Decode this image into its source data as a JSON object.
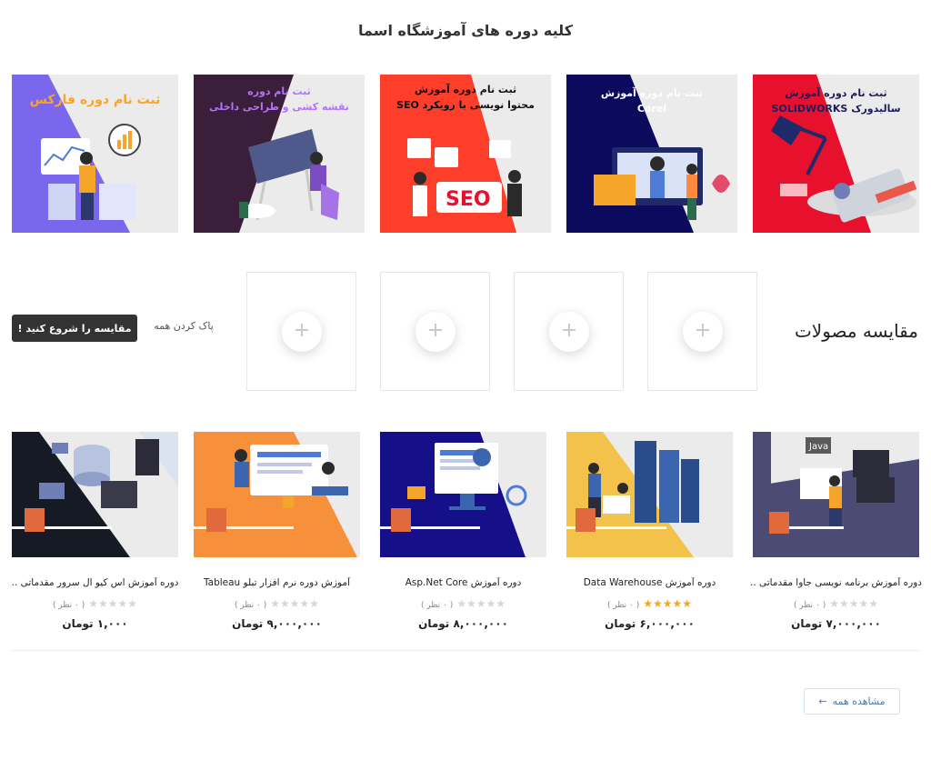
{
  "page_title": "کلیه دوره های آموزشگاه اسما",
  "banners": [
    {
      "line1": "ثبت نام دوره آموزش",
      "line2": "سالیدورک SOLIDWORKS",
      "icon": "solidworks-illustration"
    },
    {
      "line1": "ثبت نام دوره آموزش",
      "line2": "Corel",
      "icon": "corel-illustration"
    },
    {
      "line1": "ثبت نام دوره آموزش",
      "line2": "محتوا نویسی با رویکرد SEO",
      "icon": "seo-illustration"
    },
    {
      "line1": "ثبت نام دوره",
      "line2": "نقشه کشی و طراحی داخلی",
      "icon": "interior-design-illustration"
    },
    {
      "line1": "ثبت نام دوره فارکس",
      "line2": "",
      "icon": "forex-illustration"
    }
  ],
  "compare": {
    "title": "مقایسه مصولات",
    "plus_glyph": "+",
    "clear_label": "پاک کردن همه",
    "start_label": "مقایسه را شروع کنید !"
  },
  "products": [
    {
      "title": "دوره آموزش برنامه نویسی جاوا مقدماتی ..",
      "stars": 0,
      "reviews": "( ۰ نظر )",
      "price": "۷,۰۰۰,۰۰۰ تومان"
    },
    {
      "title": "دوره آموزش Data Warehouse",
      "stars": 5,
      "reviews": "( ۰ نظر )",
      "price": "۶,۰۰۰,۰۰۰ تومان"
    },
    {
      "title": "دوره آموزش Asp.Net Core",
      "stars": 0,
      "reviews": "( ۰ نظر )",
      "price": "۸,۰۰۰,۰۰۰ تومان"
    },
    {
      "title": "آموزش دوره نرم افزار تبلو Tableau",
      "stars": 0,
      "reviews": "( ۰ نظر )",
      "price": "۹,۰۰۰,۰۰۰ تومان"
    },
    {
      "title": "دوره آموزش اس کیو ال سرور مقدماتی ..",
      "stars": 0,
      "reviews": "( ۰ نظر )",
      "price": "۱,۰۰۰ تومان"
    }
  ],
  "view_all": {
    "label": "مشاهده همه",
    "arrow": "←"
  },
  "colors": {
    "star_filled": "#f5a623",
    "star_empty": "#d6d6d6",
    "button_dark": "#333333",
    "link_blue": "#4a7ab0"
  }
}
